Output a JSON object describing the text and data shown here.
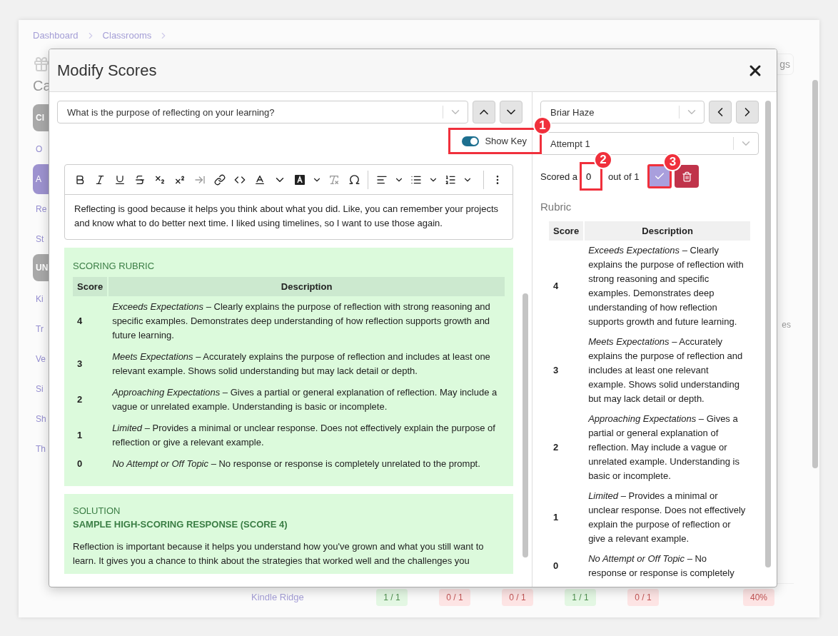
{
  "background": {
    "breadcrumb": [
      {
        "label": "Dashboard"
      },
      {
        "label": "Classrooms"
      }
    ],
    "heading": "Ca",
    "header_button": "gs",
    "sidebar": [
      {
        "label": "Cl",
        "kind": "section"
      },
      {
        "label": "O",
        "kind": "link",
        "selected": false
      },
      {
        "label": "A",
        "kind": "link",
        "selected": true
      },
      {
        "label": "Re",
        "kind": "link",
        "selected": false
      },
      {
        "label": "St",
        "kind": "link",
        "selected": false
      },
      {
        "label": "UN",
        "kind": "section"
      },
      {
        "label": "Ki",
        "kind": "link",
        "selected": false
      },
      {
        "label": "Tr",
        "kind": "link",
        "selected": false
      },
      {
        "label": "Ve",
        "kind": "link",
        "selected": false
      },
      {
        "label": "Si",
        "kind": "link",
        "selected": false
      },
      {
        "label": "Sh",
        "kind": "link",
        "selected": false
      },
      {
        "label": "Th",
        "kind": "link",
        "selected": false
      }
    ],
    "column_label": "es",
    "table_row": {
      "name": "Kindle Ridge",
      "cells": [
        {
          "text": "1 / 1",
          "kind": "pass"
        },
        {
          "text": "0 / 1",
          "kind": "fail"
        },
        {
          "text": "0 / 1",
          "kind": "fail"
        },
        {
          "text": "1 / 1",
          "kind": "pass"
        },
        {
          "text": "0 / 1",
          "kind": "fail"
        }
      ],
      "total": {
        "text": "40%",
        "kind": "fail"
      }
    }
  },
  "modal": {
    "title": "Modify Scores",
    "question_select": {
      "value": "What is the purpose of reflecting on your learning?"
    },
    "show_key": {
      "label": "Show Key",
      "on": true,
      "callout": "1"
    },
    "answer_text": "Reflecting is good because it helps you think about what you did. Like, you can remember your projects and know what to do better next time. I liked using timelines, so I want to use those again.",
    "rubric": {
      "title": "SCORING RUBRIC",
      "columns": [
        "Score",
        "Description"
      ],
      "rows": [
        {
          "score": "4",
          "text": "*Exceeds Expectations* – Clearly explains the purpose of reflection with strong reasoning and specific examples. Demonstrates deep understanding of how reflection supports growth and future learning."
        },
        {
          "score": "3",
          "text": "*Meets Expectations* – Accurately explains the purpose of reflection and includes at least one relevant example. Shows solid understanding but may lack detail or depth."
        },
        {
          "score": "2",
          "text": "*Approaching Expectations* – Gives a partial or general explanation of reflection. May include a vague or unrelated example. Understanding is basic or incomplete."
        },
        {
          "score": "1",
          "text": "*Limited* – Provides a minimal or unclear response. Does not effectively explain the purpose of reflection or give a relevant example."
        },
        {
          "score": "0",
          "text": "*No Attempt or Off Topic* – No response or response is completely unrelated to the prompt."
        }
      ]
    },
    "solution": {
      "title": "SOLUTION",
      "subtitle": "SAMPLE HIGH-SCORING RESPONSE (SCORE 4)",
      "text": "Reflection is important because it helps you understand how you've grown and what you still want to learn. It gives you a chance to think about the strategies that worked well and the challenges you"
    },
    "student_select": {
      "value": "Briar Haze"
    },
    "attempt_select": {
      "value": "Attempt 1"
    },
    "score": {
      "prefix": "Scored a",
      "value": "0",
      "callout": "2",
      "suffix": "out of 1"
    },
    "save_callout": "3",
    "side_rubric": {
      "title": "Rubric",
      "columns": [
        "Score",
        "Description"
      ],
      "rows": [
        {
          "score": "4",
          "text": "*Exceeds Expectations* – Clearly explains the purpose of reflection with strong reasoning and specific examples. Demonstrates deep understanding of how reflection supports growth and future learning."
        },
        {
          "score": "3",
          "text": "*Meets Expectations* – Accurately explains the purpose of reflection and includes at least one relevant example. Shows solid understanding but may lack detail or depth."
        },
        {
          "score": "2",
          "text": "*Approaching Expectations* – Gives a partial or general explanation of reflection. May include a vague or unrelated example. Understanding is basic or incomplete."
        },
        {
          "score": "1",
          "text": "*Limited* – Provides a minimal or unclear response. Does not effectively explain the purpose of reflection or give a relevant example."
        },
        {
          "score": "0",
          "text": "*No Attempt or Off Topic* – No response or response is completely"
        }
      ]
    }
  }
}
